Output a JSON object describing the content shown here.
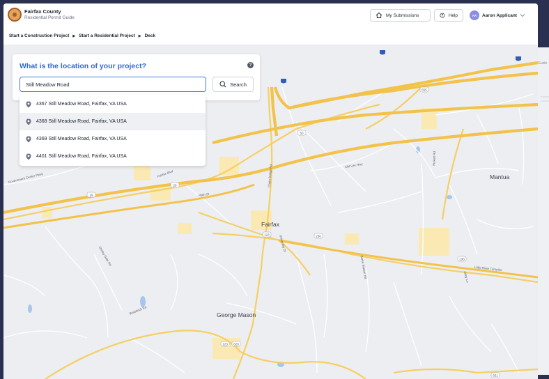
{
  "header": {
    "org_name": "Fairfax County",
    "app_name": "Residential Permit Guide",
    "submissions_label": "My Submissions",
    "help_label": "Help",
    "user_initials": "AA",
    "user_name": "Aaron Applicant"
  },
  "breadcrumb": [
    "Start a Construction Project",
    "Start a Residential Project",
    "Deck"
  ],
  "location_panel": {
    "question": "What is the location of your project?",
    "search_value": "Still Meadow Road",
    "search_button": "Search"
  },
  "suggestions": [
    "4367 Still Meadow Road, Fairfax, VA USA",
    "4368 Still Meadow Road, Fairfax, VA USA",
    "4369 Still Meadow Road, Fairfax, VA USA",
    "4401 Still Meadow Road, Fairfax, VA USA"
  ],
  "map": {
    "places": [
      "Fairfax",
      "Mantua",
      "George Mason"
    ],
    "roads": [
      "Fairfax Blvd",
      "Main St",
      "Chain Bridge Rd",
      "Old Lee Hwy",
      "Little River Turnpike",
      "Braddock Rd",
      "Government Center Pkwy",
      "University Dr",
      "Pickett Rd",
      "Burke Station Rd",
      "Olley Ln",
      "Shirley Gate Rd"
    ],
    "shields": [
      "29",
      "50",
      "123",
      "236",
      "236",
      "29",
      "123",
      "620",
      "655",
      "651"
    ]
  },
  "back_card": {
    "peek_text": "Guide"
  },
  "colors": {
    "accent": "#2f6bd8",
    "highway": "#f3c24a",
    "map_bg": "#eceef2"
  }
}
